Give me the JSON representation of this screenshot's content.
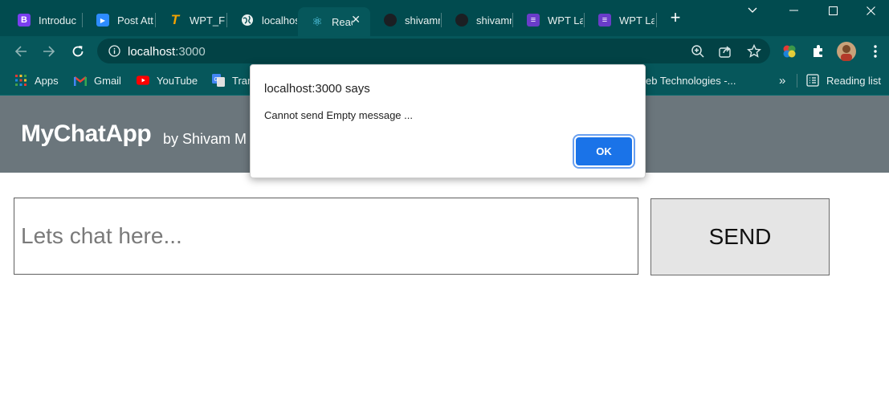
{
  "browser": {
    "tabs": [
      {
        "title": "Introduc",
        "icon": "bootstrap-icon",
        "color": "#7a3ff0",
        "glyph": "B"
      },
      {
        "title": "Post Att",
        "icon": "zoom-video-icon",
        "color": "#2d8cff",
        "glyph": "▶"
      },
      {
        "title": "WPT_Fir",
        "icon": "t-logo-icon",
        "color": "#f4a300",
        "glyph": "T"
      },
      {
        "title": "localhos",
        "icon": "globe-icon",
        "color": "#e8f0ef",
        "glyph": ""
      },
      {
        "title": "Reac",
        "icon": "react-icon",
        "color": "#61dafb",
        "glyph": "⚛"
      },
      {
        "title": "shivamr",
        "icon": "github-icon",
        "color": "#1b1f23",
        "glyph": ""
      },
      {
        "title": "shivamr",
        "icon": "github-icon",
        "color": "#1b1f23",
        "glyph": ""
      },
      {
        "title": "WPT Lal",
        "icon": "list-doc-icon",
        "color": "#6a3cc9",
        "glyph": "≡"
      },
      {
        "title": "WPT Lal",
        "icon": "list-doc-icon",
        "color": "#6a3cc9",
        "glyph": "≡"
      }
    ],
    "url_host": "localhost",
    "url_port": ":3000",
    "bookmarks": [
      {
        "label": "Apps",
        "icon": "apps-grid-icon"
      },
      {
        "label": "Gmail",
        "icon": "gmail-icon"
      },
      {
        "label": "YouTube",
        "icon": "youtube-icon"
      },
      {
        "label": "Tran",
        "icon": "google-translate-icon"
      },
      {
        "label": "eb Technologies -...",
        "icon": ""
      }
    ],
    "more_bookmarks": "»",
    "reading_list": "Reading list"
  },
  "app": {
    "title": "MyChatApp",
    "byline": "by Shivam M",
    "input_placeholder": "Lets chat here...",
    "send_label": "SEND"
  },
  "dialog": {
    "title": "localhost:3000 says",
    "message": "Cannot send Empty message ...",
    "ok_label": "OK"
  },
  "colors": {
    "tabstrip": "#014b4f",
    "toolbar": "#06575b",
    "app_header": "#6b767c",
    "accent_button": "#1a73e8"
  }
}
